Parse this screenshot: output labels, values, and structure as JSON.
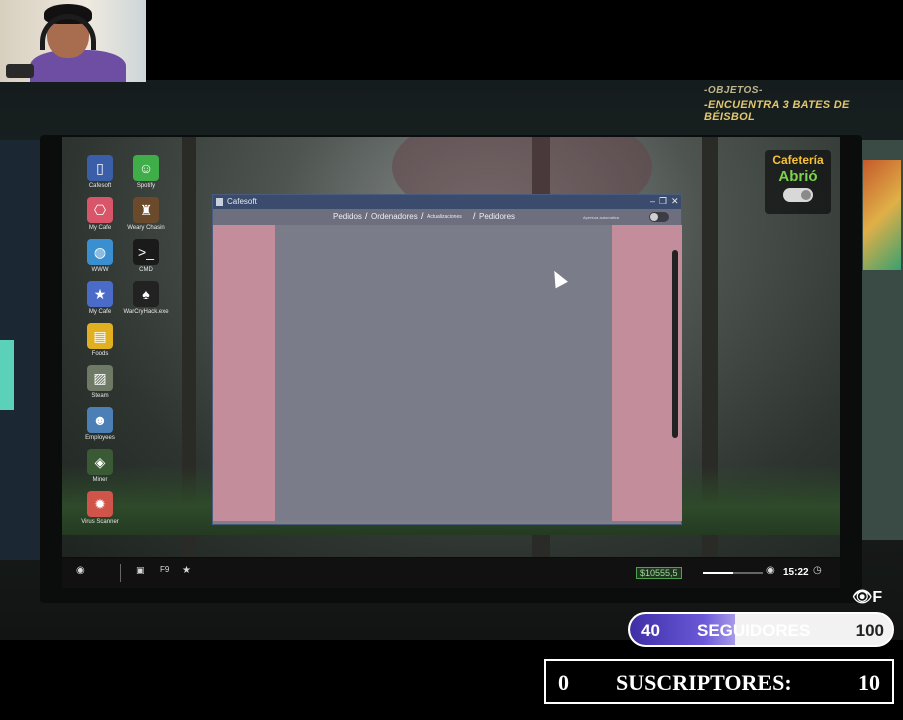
{
  "objectives": {
    "title": "-OBJETOS-",
    "item": "-ENCUENTRA 3 BATES DE BÉISBOL"
  },
  "cafe_widget": {
    "title": "Cafetería",
    "status": "Abrió",
    "toggle_on": true
  },
  "desktop_icons": [
    {
      "label": "Cafesoft",
      "icon": "cafesoft-icon",
      "color": "#3a5ea8"
    },
    {
      "label": "Spotify",
      "icon": "chat-icon",
      "color": "#3fae48"
    },
    {
      "label": "My Cafe",
      "icon": "network-icon",
      "color": "#d8556a"
    },
    {
      "label": "Weary Chasin",
      "icon": "game-icon",
      "color": "#6b4a2b"
    },
    {
      "label": "WWW",
      "icon": "globe-icon",
      "color": "#3a8fd1"
    },
    {
      "label": "CMD",
      "icon": "terminal-icon",
      "color": "#1a1a1a"
    },
    {
      "label": "My Cafe",
      "icon": "star-icon",
      "color": "#4a6cc8"
    },
    {
      "label": "WarCryHack.exe",
      "icon": "spade-icon",
      "color": "#222222"
    },
    {
      "label": "Foods",
      "icon": "food-icon",
      "color": "#e0b020"
    },
    {
      "label": "Steam",
      "icon": "package-icon",
      "color": "#6f7a66"
    },
    {
      "label": "Employees",
      "icon": "employees-icon",
      "color": "#4c7fb5"
    },
    {
      "label": "Miner",
      "icon": "miner-icon",
      "color": "#3a5a35"
    },
    {
      "label": "Virus Scanner",
      "icon": "virus-icon",
      "color": "#d0544a"
    }
  ],
  "window": {
    "title": "Cafesoft",
    "controls": {
      "minimize": "–",
      "maximize": "❐",
      "close": "✕"
    },
    "nav": {
      "tab1": "Pedidos",
      "tab2": "Ordenadores",
      "tab3": "Actualizaciones",
      "tab4": "Pedidores",
      "separator": "/",
      "toggle_label": "Apertura automática",
      "toggle_on": false
    }
  },
  "taskbar": {
    "start_icon": "◉",
    "money": "$10555,5",
    "time": "15:22",
    "volume_level": 0.5
  },
  "stream": {
    "eye_icon": "👁",
    "eye_key": "F",
    "followers": {
      "current": "40",
      "label": "SEGUIDORES",
      "goal": "100",
      "progress": 0.4
    },
    "subscribers": {
      "current": "0",
      "label": "SUSCRIPTORES:",
      "goal": "10"
    }
  }
}
